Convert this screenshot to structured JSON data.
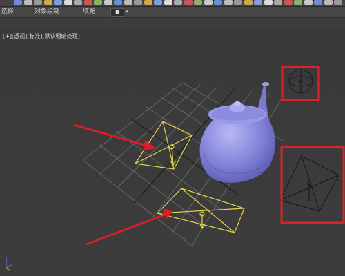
{
  "toolbar": {
    "icons": [
      "select-icon",
      "link-icon",
      "unlink-icon",
      "bind-icon",
      "filter-icon",
      "select-object-icon",
      "select-by-name-icon",
      "rect-region-icon",
      "window-crossing-icon",
      "move-icon",
      "rotate-icon",
      "scale-icon",
      "reference-coord-icon",
      "pivot-icon",
      "select-manipulate-icon",
      "keyboard-shortcut-icon",
      "snap-icon",
      "angle-snap-icon",
      "percent-snap-icon",
      "spinner-snap-icon",
      "named-selection-icon",
      "mirror-icon",
      "align-icon",
      "layer-icon",
      "scene-explorer-icon",
      "graph-editor-icon",
      "schematic-icon",
      "material-editor-icon",
      "render-setup-icon",
      "rendered-frame-icon",
      "render-icon",
      "help-icon",
      "extra-icon"
    ]
  },
  "ribbon": {
    "select_label": "选择",
    "object_paint_label": "对象绘制",
    "fill_label": "填充",
    "dropdown_value": "◘"
  },
  "viewport": {
    "label_view": "[+]",
    "label_perspective": "[透视]",
    "label_shading": "[标准]",
    "label_lighting": "[默认明暗处理]"
  },
  "colors": {
    "teapot": "#8e8ee0",
    "selected_light": "#e6d84a",
    "highlight_box": "#e0202b",
    "arrow": "#d61f26",
    "grid": "#6b6b6b",
    "background": "#3b3b3b"
  }
}
